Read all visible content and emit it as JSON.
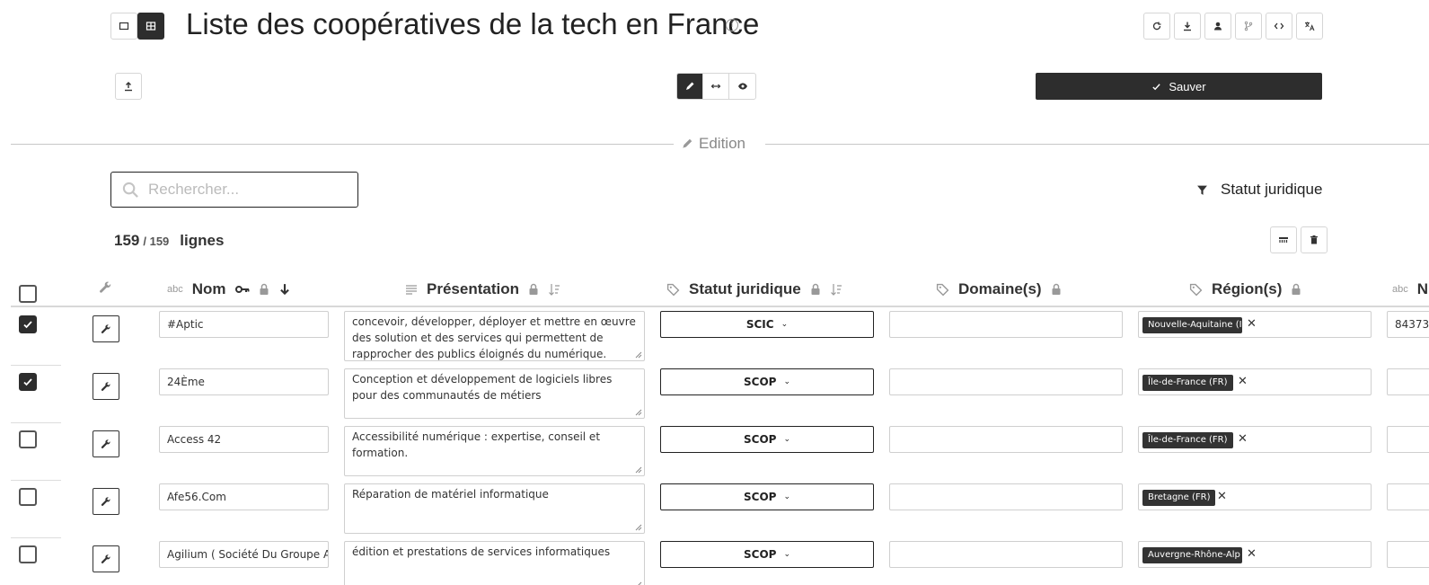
{
  "header": {
    "title": "Liste des coopératives de la tech en France",
    "view_toggle": [
      "card-view-icon",
      "table-view-icon"
    ],
    "right_tools": [
      "refresh-icon",
      "download-icon",
      "user-icon",
      "git-branch-icon",
      "code-icon",
      "translate-icon"
    ]
  },
  "toolbar": {
    "upload_icon": "upload-icon",
    "modes": [
      "edit-icon",
      "arrows-horizontal-icon",
      "eye-icon"
    ],
    "save_label": "Sauver"
  },
  "section": {
    "label": "Edition"
  },
  "search": {
    "placeholder": "Rechercher..."
  },
  "filter": {
    "label": "Statut juridique"
  },
  "count": {
    "shown": "159",
    "total": "/ 159",
    "label": "lignes"
  },
  "columns": [
    {
      "label": "Nom"
    },
    {
      "label": "Présentation"
    },
    {
      "label": "Statut juridique"
    },
    {
      "label": "Domaine(s)"
    },
    {
      "label": "Région(s)"
    },
    {
      "label": "N"
    }
  ],
  "rows": [
    {
      "checked": true,
      "nom": "#Aptic",
      "presentation": "concevoir, développer, déployer et mettre en œuvre des solution et des services qui permettent de rapprocher des publics éloignés du numérique.",
      "statut": "SCIC",
      "domaine": "",
      "region": "Nouvelle-Aquitaine (I",
      "n": "84373"
    },
    {
      "checked": true,
      "nom": "24Ème",
      "presentation": "Conception et développement de logiciels libres pour des communautés de métiers",
      "statut": "SCOP",
      "domaine": "",
      "region": "Île-de-France (FR)",
      "n": ""
    },
    {
      "checked": false,
      "nom": "Access 42",
      "presentation": "Accessibilité numérique : expertise, conseil et formation.",
      "statut": "SCOP",
      "domaine": "",
      "region": "Île-de-France (FR)",
      "n": ""
    },
    {
      "checked": false,
      "nom": "Afe56.Com",
      "presentation": "Réparation de matériel informatique",
      "statut": "SCOP",
      "domaine": "",
      "region": "Bretagne (FR)",
      "n": ""
    },
    {
      "checked": false,
      "nom": "Agilium ( Société Du Groupe A",
      "presentation": "édition et prestations de services informatiques",
      "statut": "SCOP",
      "domaine": "",
      "region": "Auvergne-Rhône-Alp",
      "n": ""
    }
  ]
}
